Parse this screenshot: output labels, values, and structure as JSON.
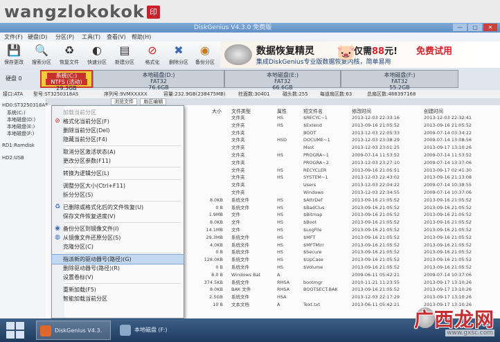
{
  "watermark": {
    "text": "wangzlokokok",
    "seal": "印"
  },
  "window": {
    "title": "DiskGenius V4.3.0 免费版",
    "btn_min": "—",
    "btn_max": "□",
    "btn_close": "✕"
  },
  "menubar": [
    "文件(F)",
    "硬盘(D)",
    "分区(P)",
    "工具(T)",
    "查看(V)",
    "帮助(H)"
  ],
  "toolbar": [
    {
      "label": "保存更改",
      "icon": "save-icon",
      "glyph": "💾"
    },
    {
      "label": "搜索分区",
      "icon": "search-icon",
      "glyph": "🔍"
    },
    {
      "label": "恢复文件",
      "icon": "recover-icon",
      "glyph": "♻"
    },
    {
      "label": "快速分区",
      "icon": "partition-icon",
      "glyph": "◐"
    },
    {
      "label": "新建分区",
      "icon": "new-partition-icon",
      "glyph": "▤"
    },
    {
      "label": "格式化",
      "icon": "format-icon",
      "glyph": "⊘"
    },
    {
      "label": "删除分区",
      "icon": "delete-icon",
      "glyph": "✖"
    },
    {
      "label": "备份分区",
      "icon": "backup-icon",
      "glyph": "◉"
    }
  ],
  "ad": {
    "title": "数据恢复精灵",
    "price_prefix": "仅需",
    "price": "88",
    "price_suffix": "元!",
    "free": "免费试用",
    "subtitle": "集成DiskGenius专业版数据恢复内核，简单易用"
  },
  "disk_label": "硬盘 0",
  "partitions": [
    {
      "name": "系统(C:)",
      "fs": "NTFS (活动)",
      "size": "29.3GB",
      "highlight": true
    },
    {
      "name": "本地磁盘(D:)",
      "fs": "FAT32",
      "size": "76.6GB",
      "highlight": false
    },
    {
      "name": "本地磁盘(E:)",
      "fs": "FAT32",
      "size": "66.6GB",
      "highlight": false
    },
    {
      "name": "本地磁盘(F:)",
      "fs": "FAT32",
      "size": "55.2GB",
      "highlight": false
    }
  ],
  "disk_info": {
    "iface": "接口:ATA",
    "model": "型号:ST3250318AS",
    "serial": "序列号:9VMXXXXX",
    "capacity": "容量:232.9GB(238475MB)",
    "cylinders": "柱面数:30401",
    "heads": "磁头数:255",
    "sectors": "每道扇区数:63",
    "total": "总扇区数:488397168"
  },
  "tree": [
    "HD0:ST3250318AS",
    "系统(C:)",
    "本地磁盘(D:)",
    "本地磁盘(E:)",
    "本地磁盘(F:)",
    "RD1:Ramdisk",
    "HD2:USB"
  ],
  "tabs": [
    "浏览文件",
    "扇区编辑"
  ],
  "columns": [
    "大小",
    "文件类型",
    "属性",
    "短文件名",
    "修改时间",
    "创建时间"
  ],
  "files": [
    {
      "size": "",
      "type": "文件夹",
      "attr": "HS",
      "short": "$RECYC~1",
      "mtime": "2013-12-03 22:33:16",
      "ctime": "2013-12-03 22:32:41"
    },
    {
      "size": "",
      "type": "文件夹",
      "attr": "HS",
      "short": "$Extend",
      "mtime": "2013-09-16 21:05:52",
      "ctime": "2013-09-16 21:05:52"
    },
    {
      "size": "",
      "type": "文件夹",
      "attr": "",
      "short": "BOOT",
      "mtime": "2013-12-03 22:05:33",
      "ctime": "2009-07-14 03:34:22"
    },
    {
      "size": "",
      "type": "文件夹",
      "attr": "HSD",
      "short": "DOCUME~1",
      "mtime": "2013-12-03 23:38:29",
      "ctime": "2009-07-14 13:08:56"
    },
    {
      "size": "",
      "type": "文件夹",
      "attr": "",
      "short": "Msot",
      "mtime": "2013-12-03 23:01:25",
      "ctime": "2013-09-17 13:10:26"
    },
    {
      "size": "",
      "type": "文件夹",
      "attr": "HS",
      "short": "PROGRA~1",
      "mtime": "2009-07-14 11:53:52",
      "ctime": "2009-07-14 11:53:52"
    },
    {
      "size": "",
      "type": "文件夹",
      "attr": "",
      "short": "PROGRA~2",
      "mtime": "2013-12-03 23:27:10",
      "ctime": "2009-07-14 13:37:06"
    },
    {
      "size": "",
      "type": "文件夹",
      "attr": "HS",
      "short": "RECYCLER",
      "mtime": "2013-09-16 21:05:51",
      "ctime": "2013-09-17 02:41:30"
    },
    {
      "size": "",
      "type": "文件夹",
      "attr": "HS",
      "short": "SYSTEM~1",
      "mtime": "2013-12-03 22:43:02",
      "ctime": "2013-09-16 21:13:08"
    },
    {
      "size": "",
      "type": "文件夹",
      "attr": "",
      "short": "Users",
      "mtime": "2013-12-03 22:04:22",
      "ctime": "2009-07-14 10:38:55"
    },
    {
      "size": "",
      "type": "文件夹",
      "attr": "",
      "short": "Windows",
      "mtime": "2013-12-03 22:34:55",
      "ctime": "2009-07-14 10:37:06"
    },
    {
      "size": "8.0KB",
      "type": "系统文件",
      "attr": "HS",
      "short": "$AttrDef",
      "mtime": "2013-09-16 21:05:52",
      "ctime": "2013-09-16 21:05:52"
    },
    {
      "size": "0 B",
      "type": "系统文件",
      "attr": "HS",
      "short": "$BadClus",
      "mtime": "2013-09-16 21:05:52",
      "ctime": "2013-09-16 21:05:52"
    },
    {
      "size": "1.9MB",
      "type": "文件",
      "attr": "HS",
      "short": "$Bitmap",
      "mtime": "2013-09-16 21:05:52",
      "ctime": "2013-09-16 21:05:52"
    },
    {
      "size": "8.0KB",
      "type": "文件",
      "attr": "HS",
      "short": "$Boot",
      "mtime": "2013-09-16 21:05:52",
      "ctime": "2013-09-16 21:05:52"
    },
    {
      "size": "14.1MB",
      "type": "文件",
      "attr": "HS",
      "short": "$LogFile",
      "mtime": "2013-09-16 21:05:52",
      "ctime": "2013-09-16 21:05:52"
    },
    {
      "size": "29.3MB",
      "type": "系统文件",
      "attr": "HS",
      "short": "$MFT",
      "mtime": "2013-09-16 21:05:52",
      "ctime": "2013-09-16 21:05:52"
    },
    {
      "size": "4.0KB",
      "type": "系统文件",
      "attr": "HS",
      "short": "$MFTMirr",
      "mtime": "2013-09-16 21:05:52",
      "ctime": "2013-09-16 21:05:52"
    },
    {
      "size": "0 B",
      "type": "系统文件",
      "attr": "HS",
      "short": "$Secure",
      "mtime": "2013-09-16 21:05:52",
      "ctime": "2013-09-16 21:05:52"
    },
    {
      "size": "128.0KB",
      "type": "系统文件",
      "attr": "HS",
      "short": "$UpCase",
      "mtime": "2013-09-16 21:05:52",
      "ctime": "2013-09-16 21:05:52"
    },
    {
      "size": "0 B",
      "type": "系统文件",
      "attr": "HS",
      "short": "$Volume",
      "mtime": "2013-09-16 21:05:52",
      "ctime": "2013-09-16 21:05:52"
    },
    {
      "size": "8.0 B",
      "type": "Windows Bat",
      "attr": "A",
      "short": "",
      "mtime": "2009-06-11 05:42:21",
      "ctime": "2009-07-14 10:37:06"
    },
    {
      "size": "374.5KB",
      "type": "系统文件",
      "attr": "RHSA",
      "short": "bootmgr",
      "mtime": "2010-11-21 11:23:55",
      "ctime": "2013-09-17 13:10:26"
    },
    {
      "size": "8.0KB",
      "type": "BAK 文件",
      "attr": "RHSA",
      "short": "BOOTSECT.BAK",
      "mtime": "2013-09-16 21:05:52",
      "ctime": "2013-09-17 13:10:26"
    },
    {
      "size": "2.5GB",
      "type": "系统文件",
      "attr": "HSA",
      "short": "",
      "mtime": "2013-12-03 22:17:29",
      "ctime": "2013-09-17 13:10:26"
    },
    {
      "size": "10 B",
      "type": "文本文档",
      "attr": "A",
      "short": "Text.txt",
      "mtime": "2013-06-11 05:42:21",
      "ctime": "2013-09-17 13:10:26"
    }
  ],
  "context_menu": [
    {
      "label": "加载当前分区",
      "icon": "",
      "dim": true
    },
    {
      "label": "格式化当前分区(F)",
      "icon": "format-icon",
      "dim": false
    },
    {
      "label": "删除当前分区(Del)",
      "icon": "",
      "dim": false
    },
    {
      "label": "隐藏当前分区(F4)",
      "icon": "",
      "dim": false
    },
    {
      "sep": true
    },
    {
      "label": "取消分区激活状态(A)",
      "icon": "",
      "dim": false
    },
    {
      "label": "更改分区参数(F11)",
      "icon": "",
      "dim": false
    },
    {
      "sep": true
    },
    {
      "label": "转换为逻辑分区(L)",
      "icon": "",
      "dim": false
    },
    {
      "sep": true
    },
    {
      "label": "调整分区大小(Ctrl+F11)",
      "icon": "",
      "dim": false
    },
    {
      "label": "拆分分区(S)",
      "icon": "",
      "dim": false
    },
    {
      "sep": true
    },
    {
      "label": "已删除或格式化后的文件恢复(U)",
      "icon": "recover-icon",
      "dim": false
    },
    {
      "label": "保存文件恢复进度(V)",
      "icon": "",
      "dim": false
    },
    {
      "sep": true
    },
    {
      "label": "备份分区到镜像文件(I)",
      "icon": "backup-icon",
      "dim": false
    },
    {
      "label": "从镜像文件还原分区(S)",
      "icon": "restore-icon",
      "dim": false
    },
    {
      "label": "克隆分区(C)",
      "icon": "",
      "dim": false
    },
    {
      "sep": true
    },
    {
      "label": "指派新的驱动器号(路径)(G)",
      "icon": "",
      "dim": false,
      "hl": true
    },
    {
      "label": "删除驱动器号(路径)(R)",
      "icon": "",
      "dim": false
    },
    {
      "label": "设置卷标(V)",
      "icon": "",
      "dim": false
    },
    {
      "sep": true
    },
    {
      "label": "重新加载(F5)",
      "icon": "",
      "dim": false
    },
    {
      "label": "智能加载当前分区",
      "icon": "",
      "dim": false
    }
  ],
  "taskbar": [
    {
      "label": "DiskGenius V4.3.",
      "active": true,
      "color": "#e0662c"
    },
    {
      "label": "本地磁盘 (F:)",
      "active": false,
      "color": "#8aa9c9"
    }
  ],
  "logo": {
    "text": "广西龙网",
    "url": "www.gxsc.com"
  }
}
